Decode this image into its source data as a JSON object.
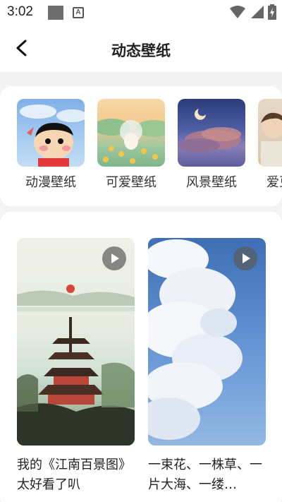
{
  "status_bar": {
    "time": "3:02",
    "icons": [
      "notification-square-icon",
      "a-app-icon",
      "wifi-icon",
      "signal-icon",
      "battery-icon"
    ]
  },
  "header": {
    "title": "动态壁纸",
    "back_icon": "chevron-left-icon"
  },
  "categories": [
    {
      "label": "动漫壁纸"
    },
    {
      "label": "可爱壁纸"
    },
    {
      "label": "风景壁纸"
    },
    {
      "label": "爱豆壁纸"
    }
  ],
  "wallpapers": [
    {
      "title": "我的《江南百景图》太好看了叭",
      "has_play": true
    },
    {
      "title": "一束花、一株草、一片大海、一缕…",
      "has_play": true
    }
  ],
  "colors": {
    "background": "#f3f3f3",
    "card": "#ffffff",
    "text": "#222222",
    "play_overlay": "#5a5a5a"
  }
}
